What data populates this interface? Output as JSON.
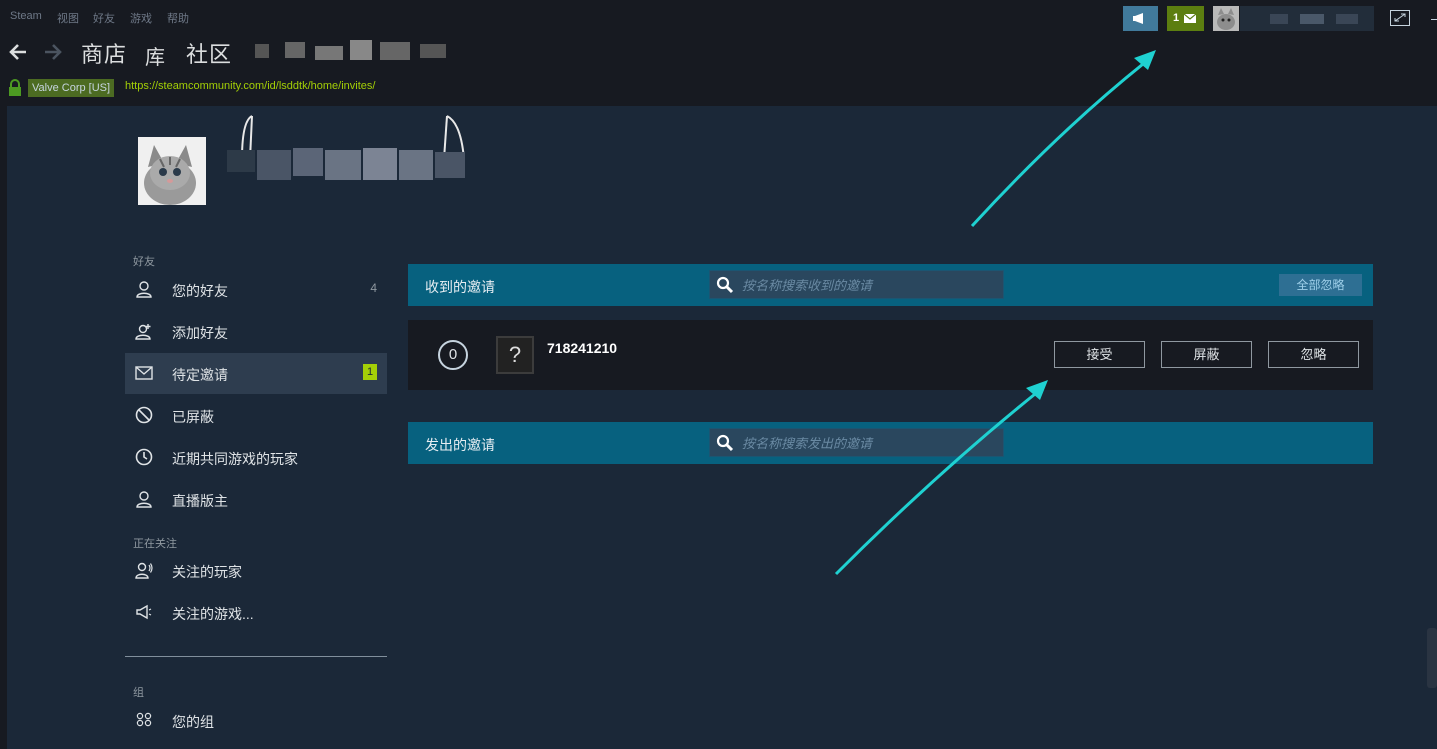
{
  "menubar": {
    "items": [
      "Steam",
      "视图",
      "好友",
      "游戏",
      "帮助"
    ]
  },
  "topbar": {
    "mail_count": "1"
  },
  "nav": {
    "store": "商店",
    "library": "库",
    "community": "社区"
  },
  "address": {
    "cert": "Valve Corp [US]",
    "url": "https://steamcommunity.com/id/lsddtk/home/invites/"
  },
  "sidebar": {
    "friends_section": "好友",
    "items": [
      {
        "label": "您的好友",
        "count": "4"
      },
      {
        "label": "添加好友"
      },
      {
        "label": "待定邀请",
        "badge": "1"
      },
      {
        "label": "已屏蔽"
      },
      {
        "label": "近期共同游戏的玩家"
      },
      {
        "label": "直播版主"
      }
    ],
    "following_section": "正在关注",
    "following": [
      {
        "label": "关注的玩家"
      },
      {
        "label": "关注的游戏..."
      }
    ],
    "groups_section": "组",
    "groups": [
      {
        "label": "您的组"
      }
    ]
  },
  "received": {
    "title": "收到的邀请",
    "search_placeholder": "按名称搜索收到的邀请",
    "ignore_all": "全部忽略",
    "invite": {
      "level": "0",
      "avatar_text": "?",
      "name": "718241210",
      "accept": "接受",
      "block": "屏蔽",
      "ignore": "忽略"
    }
  },
  "sent": {
    "title": "发出的邀请",
    "search_placeholder": "按名称搜索发出的邀请"
  },
  "colors": {
    "accent": "#07617f",
    "badge": "#a4d007",
    "annotation": "#1fd1d1"
  }
}
